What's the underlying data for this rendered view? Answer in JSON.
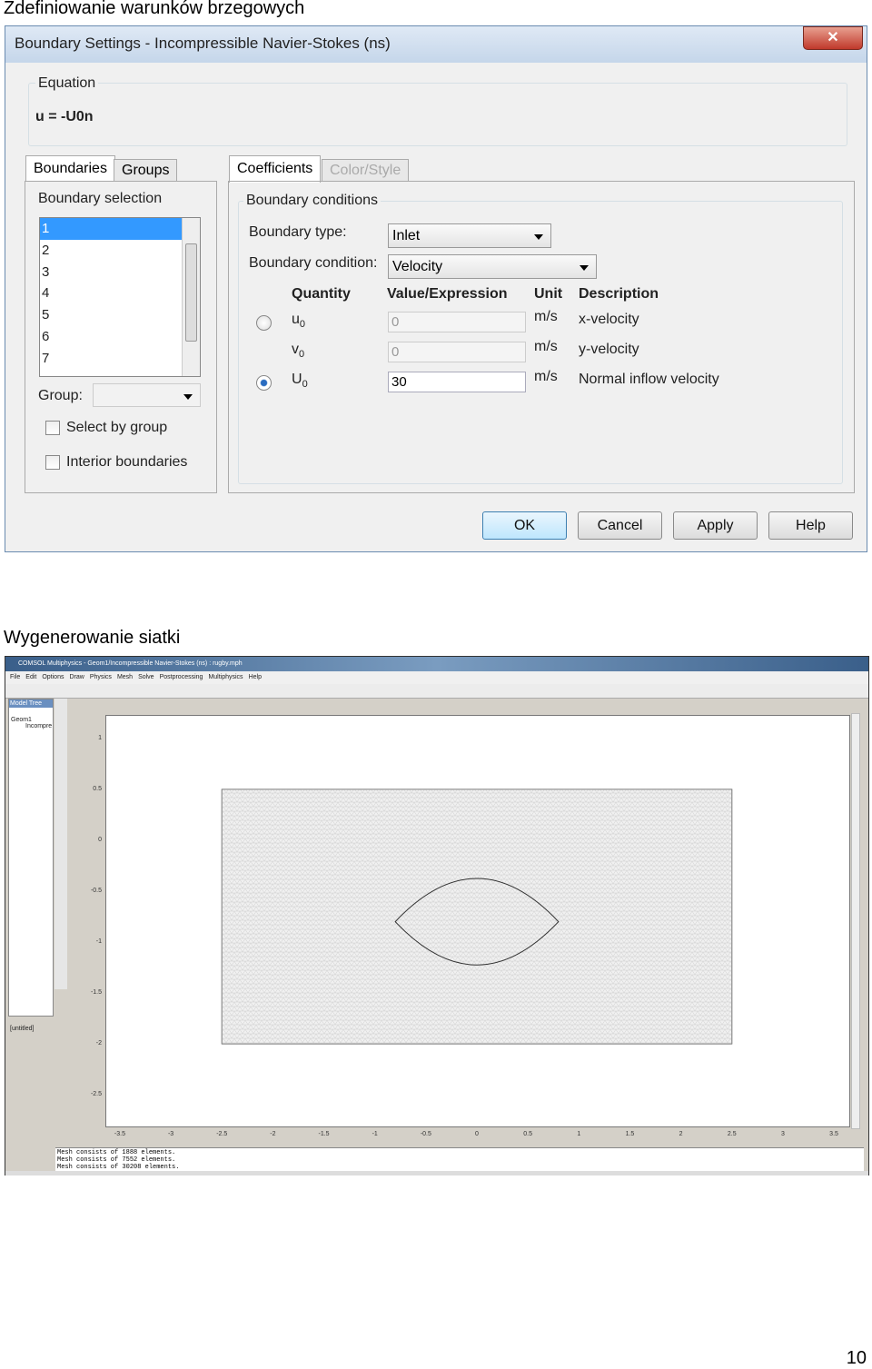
{
  "section1_caption": "Zdefiniowanie warunków brzegowych",
  "section2_caption": "Wygenerowanie siatki",
  "page_number": "10",
  "dialog": {
    "title": "Boundary Settings - Incompressible Navier-Stokes (ns)",
    "close": "✕",
    "equation_label": "Equation",
    "equation": "u = -U0n",
    "left_tabs": [
      "Boundaries",
      "Groups"
    ],
    "boundary_selection_label": "Boundary selection",
    "boundaries": [
      "1",
      "2",
      "3",
      "4",
      "5",
      "6",
      "7"
    ],
    "selected_boundary": "1",
    "group_label": "Group:",
    "select_by_group": "Select by group",
    "interior_boundaries": "Interior boundaries",
    "right_tabs": [
      "Coefficients",
      "Color/Style"
    ],
    "boundary_conditions_label": "Boundary conditions",
    "boundary_type_label": "Boundary type:",
    "boundary_type": "Inlet",
    "boundary_condition_label": "Boundary condition:",
    "boundary_condition": "Velocity",
    "headers": [
      "Quantity",
      "Value/Expression",
      "Unit",
      "Description"
    ],
    "rows": [
      {
        "q": "u",
        "sub": "0",
        "value": "0",
        "unit": "m/s",
        "desc": "x-velocity",
        "radio": false,
        "enabled": false
      },
      {
        "q": "v",
        "sub": "0",
        "value": "0",
        "unit": "m/s",
        "desc": "y-velocity",
        "radio": null,
        "enabled": false
      },
      {
        "q": "U",
        "sub": "0",
        "value": "30",
        "unit": "m/s",
        "desc": "Normal inflow velocity",
        "radio": true,
        "enabled": true
      }
    ],
    "buttons": [
      "OK",
      "Cancel",
      "Apply",
      "Help"
    ]
  },
  "app": {
    "title": "COMSOL Multiphysics - Geom1/Incompressible Navier-Stokes (ns) : rugby.mph",
    "menu": [
      "File",
      "Edit",
      "Options",
      "Draw",
      "Physics",
      "Mesh",
      "Solve",
      "Postprocessing",
      "Multiphysics",
      "Help"
    ],
    "model_tree_label": "Model Tree",
    "tree": [
      "Geom1",
      "Incompre"
    ],
    "untitled": "[untitled]",
    "x_ticks": [
      "-3.5",
      "-3",
      "-2.5",
      "-2",
      "-1.5",
      "-1",
      "-0.5",
      "0",
      "0.5",
      "1",
      "1.5",
      "2",
      "2.5",
      "3",
      "3.5"
    ],
    "y_ticks": [
      "1",
      "0.5",
      "0",
      "-0.5",
      "-1",
      "-1.5",
      "-2",
      "-2.5"
    ],
    "log": [
      "Mesh consists of 1888 elements.",
      "Mesh consists of 7552 elements.",
      "Mesh consists of 30208 elements."
    ]
  }
}
